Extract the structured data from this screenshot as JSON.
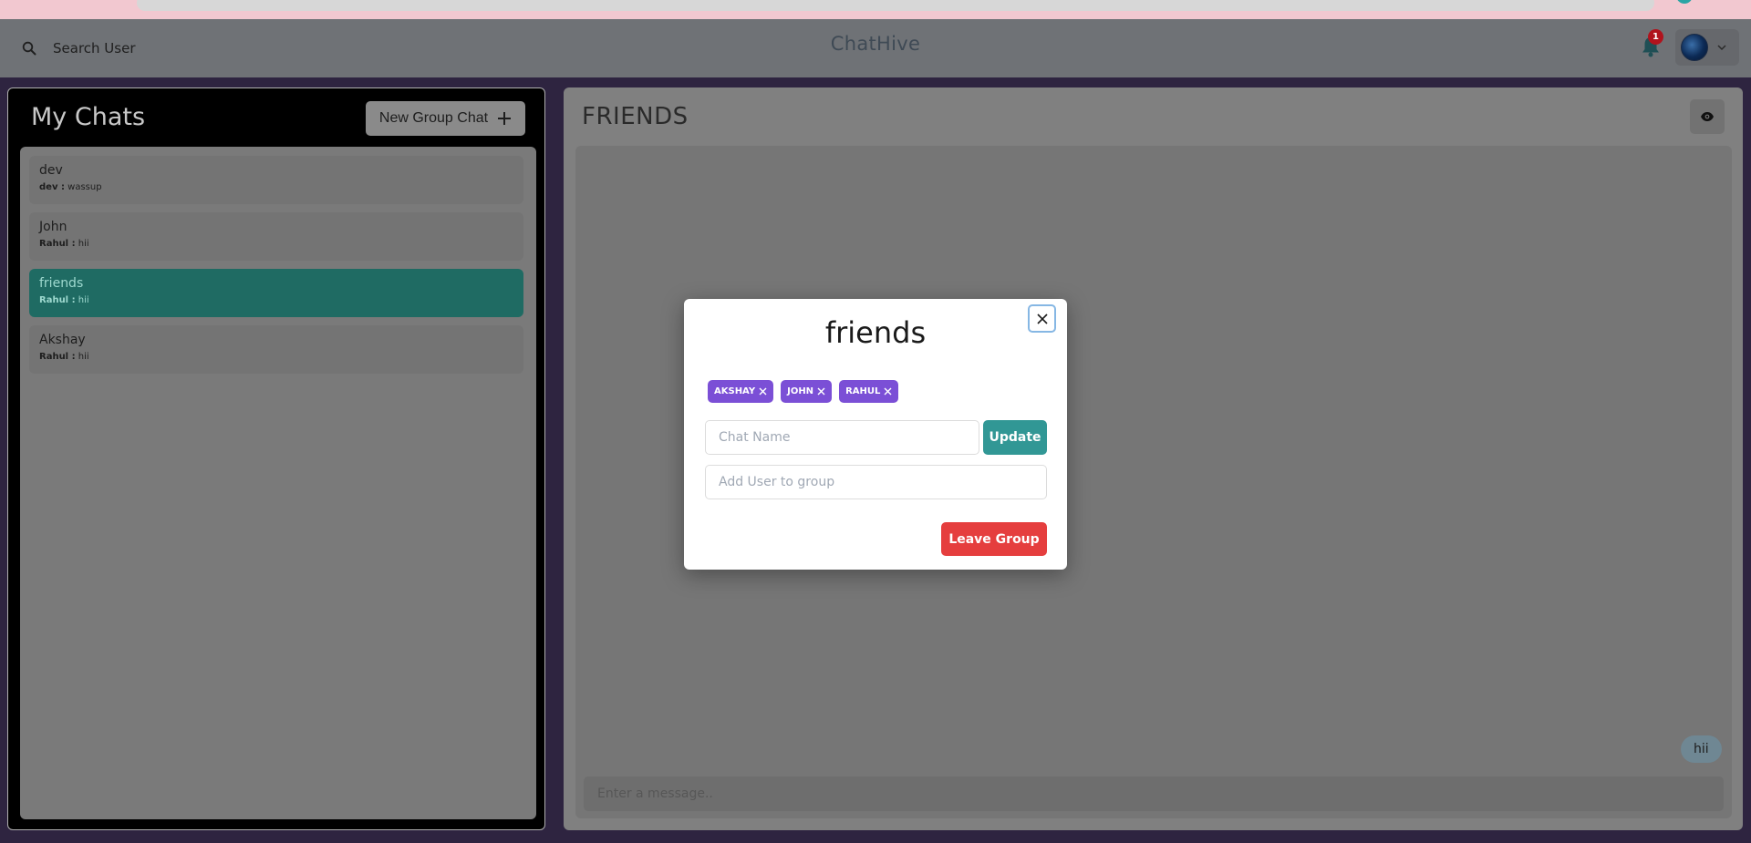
{
  "header": {
    "search_label": "Search User",
    "app_title": "ChatHive",
    "notification_count": "1"
  },
  "sidebar": {
    "title": "My Chats",
    "new_group_label": "New Group Chat",
    "chats": [
      {
        "name": "dev",
        "sender": "dev :",
        "message": "wassup",
        "active": false
      },
      {
        "name": "John",
        "sender": "Rahul :",
        "message": "hii",
        "active": false
      },
      {
        "name": "friends",
        "sender": "Rahul :",
        "message": "hii",
        "active": true
      },
      {
        "name": "Akshay",
        "sender": "Rahul :",
        "message": "hii",
        "active": false
      }
    ]
  },
  "chat": {
    "title": "FRIENDS",
    "message_bubble": "hii",
    "input_placeholder": "Enter a message.."
  },
  "modal": {
    "title": "friends",
    "members": [
      "AKSHAY",
      "JOHN",
      "RAHUL"
    ],
    "chat_name_placeholder": "Chat Name",
    "update_label": "Update",
    "add_user_placeholder": "Add User to group",
    "leave_label": "Leave Group"
  },
  "colors": {
    "accent_teal": "#319795",
    "tag_purple": "#7b4fd6",
    "leave_red": "#e53e3e",
    "active_chat": "#1f6b63"
  }
}
